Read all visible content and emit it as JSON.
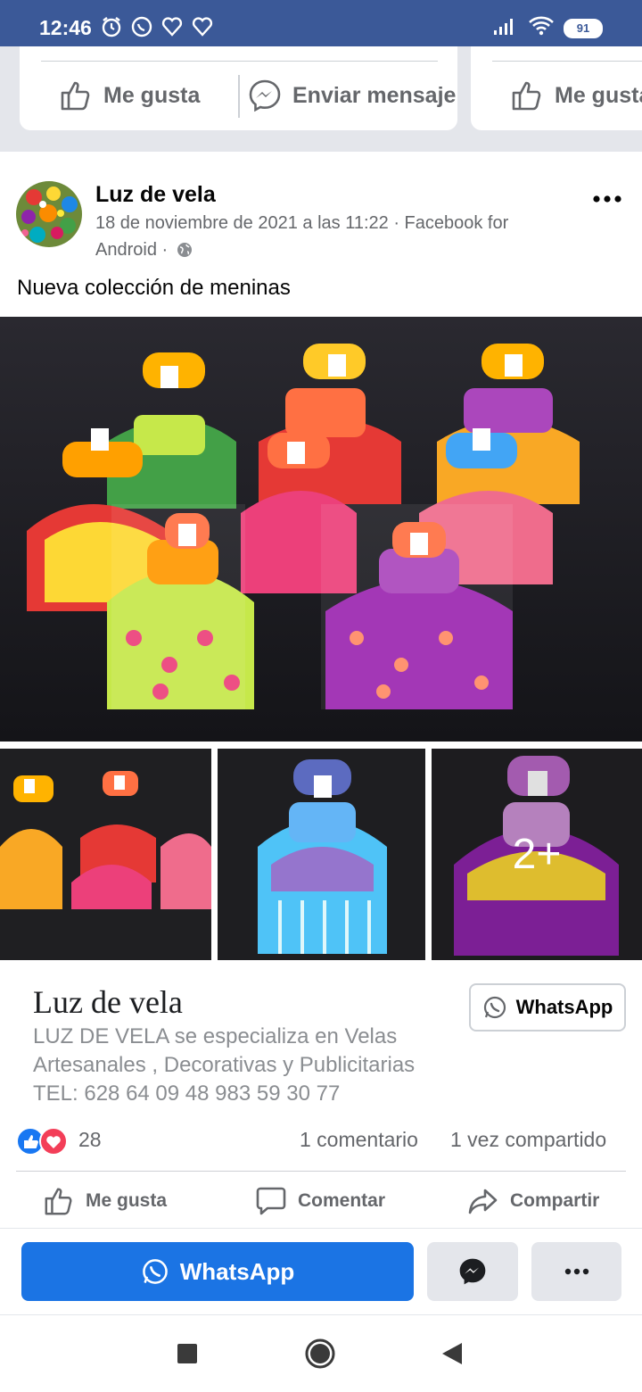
{
  "status_bar": {
    "time": "12:46",
    "battery": "91",
    "icons": [
      "alarm-icon",
      "whatsapp-icon",
      "heart-icon",
      "heart-icon",
      "signal-icon",
      "wifi-icon",
      "battery-icon"
    ]
  },
  "top_cards": {
    "like_label": "Me gusta",
    "message_label": "Enviar mensaje",
    "like_label_2": "Me gusta"
  },
  "post": {
    "author": "Luz de vela",
    "meta": "18 de noviembre de 2021 a las 11:22 · Facebook for Android ·",
    "text": "Nueva colección de meninas",
    "more_photos": "2+"
  },
  "link_preview": {
    "title": "Luz de vela",
    "description": "LUZ DE VELA se especializa en Velas Artesanales , Decorativas y Publicitarias",
    "phone": "TEL: 628 64 09 48 983 59 30 77",
    "button_label": "WhatsApp"
  },
  "engagement": {
    "reactions": "28",
    "comments": "1 comentario",
    "shares": "1 vez compartido"
  },
  "actions": {
    "like": "Me gusta",
    "comment": "Comentar",
    "share": "Compartir"
  },
  "cta": {
    "whatsapp": "WhatsApp"
  },
  "colors": {
    "status_bar": "#3b5998",
    "brand_blue": "#1b74e4",
    "secondary_text": "#65676b"
  }
}
